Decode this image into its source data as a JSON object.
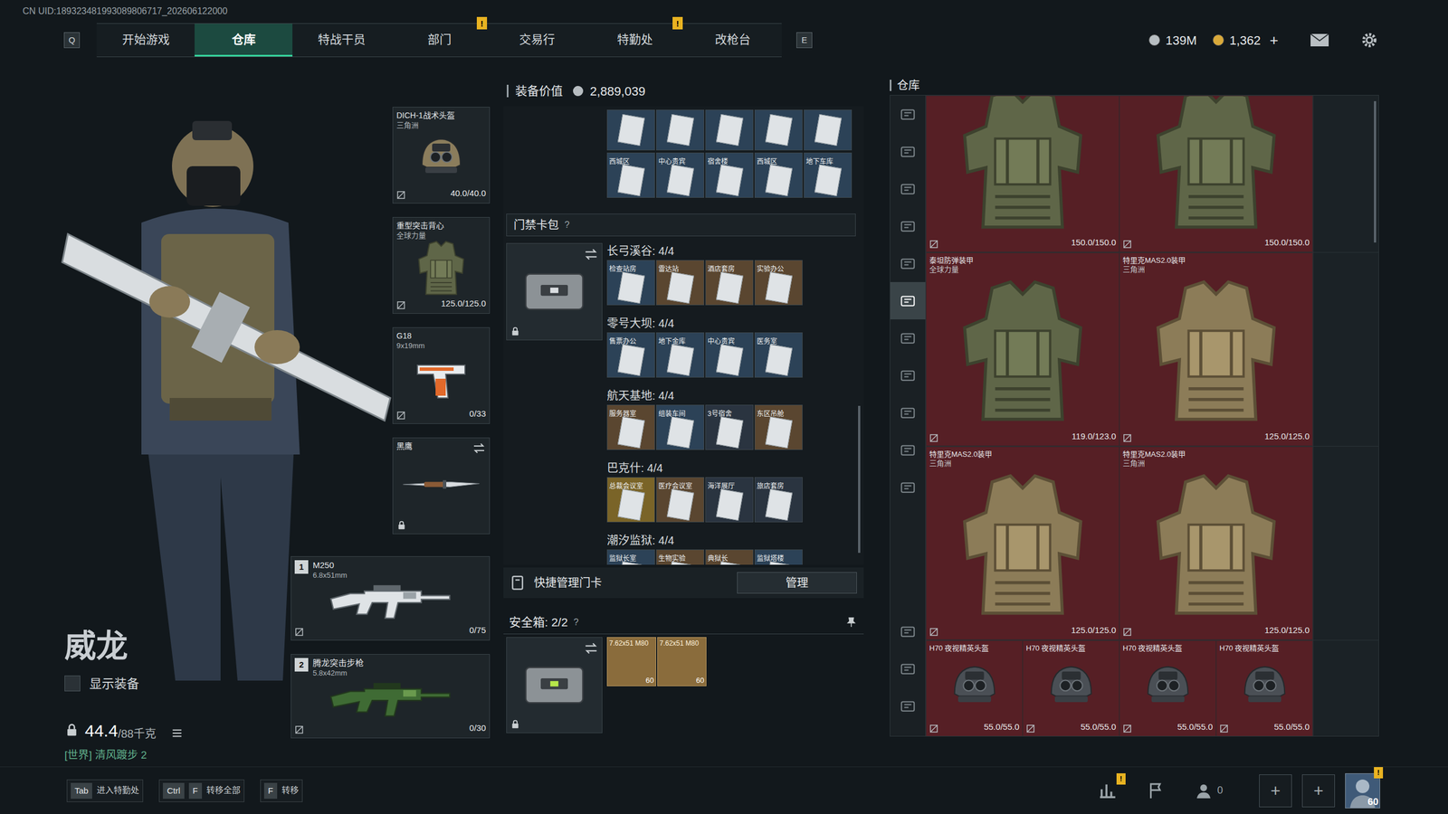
{
  "uid": "CN UID:189323481993089806717_202606122000",
  "nav": {
    "prev_key": "Q",
    "next_key": "E",
    "tabs": [
      {
        "label": "开始游戏",
        "selected": false
      },
      {
        "label": "仓库",
        "selected": true
      },
      {
        "label": "特战干员",
        "selected": false
      },
      {
        "label": "部门",
        "selected": false,
        "badge": "!"
      },
      {
        "label": "交易行",
        "selected": false
      },
      {
        "label": "特勤处",
        "selected": false,
        "badge": "!"
      },
      {
        "label": "改枪台",
        "selected": false
      }
    ]
  },
  "currency": [
    {
      "kind": "silver",
      "amount": "139M"
    },
    {
      "kind": "gold",
      "amount": "1,362"
    }
  ],
  "currency_add": "+",
  "operator": {
    "name": "威龙",
    "show_gear": {
      "label": "显示装备",
      "checked": false
    },
    "weight": {
      "current": "44.4",
      "max": "/88千克"
    },
    "world": "[世界] 清风踱步 2"
  },
  "gear": [
    {
      "kind": "helmet",
      "name": "DICH-1战术头盔",
      "sub": "三角洲",
      "durability": "40.0/40.0",
      "locked": false,
      "swap": false
    },
    {
      "kind": "vest",
      "name": "重型突击背心",
      "sub": "全球力量",
      "durability": "125.0/125.0",
      "locked": false,
      "swap": false
    },
    {
      "kind": "pistol",
      "name": "G18",
      "sub": "9x19mm",
      "durability": "0/33",
      "locked": false,
      "swap": false
    },
    {
      "kind": "knife",
      "name": "黑鹰",
      "locked": true,
      "swap": true
    }
  ],
  "weapons": [
    {
      "kind": "lmg",
      "slot": "1",
      "name": "M250",
      "caliber": "6.8x51mm",
      "ammo": "0/75"
    },
    {
      "kind": "rifle",
      "slot": "2",
      "name": "腾龙突击步枪",
      "caliber": "5.8x42mm",
      "ammo": "0/30"
    }
  ],
  "loadout": {
    "title": "装备价值",
    "value": "2,889,039",
    "top_cards_cut": [
      {
        "color": "#2c4257"
      },
      {
        "color": "#2c4257"
      },
      {
        "color": "#2c4257"
      },
      {
        "color": "#2c4257"
      },
      {
        "color": "#2c4257"
      }
    ],
    "top_cards": [
      {
        "label": "西城区",
        "color": "#2c4257"
      },
      {
        "label": "中心贵宾",
        "color": "#2c4257"
      },
      {
        "label": "宿舍楼",
        "color": "#2c4257"
      },
      {
        "label": "西城区",
        "color": "#2c4257"
      },
      {
        "label": "地下车库",
        "color": "#2c4257"
      }
    ],
    "keycard_pack": {
      "title": "门禁卡包",
      "help": "?",
      "locked": true
    },
    "groups": [
      {
        "title": "长弓溪谷: 4/4",
        "cards": [
          {
            "label": "检查站房",
            "color": "#2c4257"
          },
          {
            "label": "雷达站",
            "color": "#5a4630"
          },
          {
            "label": "酒店套房",
            "color": "#5a4630"
          },
          {
            "label": "实验办公",
            "color": "#5a4630"
          }
        ]
      },
      {
        "title": "零号大坝: 4/4",
        "cards": [
          {
            "label": "售票办公",
            "color": "#2c4257"
          },
          {
            "label": "地下金库",
            "color": "#2c4257"
          },
          {
            "label": "中心贵宾",
            "color": "#2c4257"
          },
          {
            "label": "医务室",
            "color": "#2c4257"
          }
        ]
      },
      {
        "title": "航天基地: 4/4",
        "cards": [
          {
            "label": "服务器室",
            "color": "#5a4630"
          },
          {
            "label": "组装车间",
            "color": "#2c4257"
          },
          {
            "label": "3号宿舍",
            "color": "#2a3440"
          },
          {
            "label": "东区吊舱",
            "color": "#5a4630"
          }
        ]
      },
      {
        "title": "巴克什: 4/4",
        "cards": [
          {
            "label": "总裁会议室",
            "color": "#7a6428"
          },
          {
            "label": "医疗会议室",
            "color": "#5a4630"
          },
          {
            "label": "海洋展厅",
            "color": "#2a3440"
          },
          {
            "label": "旅店套房",
            "color": "#2a3440"
          }
        ]
      },
      {
        "title": "潮汐监狱: 4/4",
        "cards": [
          {
            "label": "监狱长室",
            "color": "#2c4257"
          },
          {
            "label": "生物实验",
            "color": "#5a4630"
          },
          {
            "label": "典狱长",
            "color": "#5a4630"
          },
          {
            "label": "监狱塔楼",
            "color": "#2c4257"
          }
        ]
      }
    ],
    "quick_manage": {
      "label": "快捷管理门卡",
      "button": "管理"
    },
    "safebox": {
      "title": "安全箱: 2/2",
      "help": "?",
      "locked": true,
      "items": [
        {
          "name": "7.62x51 M80",
          "count": "60"
        },
        {
          "name": "7.62x51 M80",
          "count": "60"
        }
      ]
    }
  },
  "warehouse": {
    "title": "仓库",
    "sidebar_top": [
      {
        "selected": false
      },
      {
        "selected": false
      },
      {
        "selected": false
      },
      {
        "selected": false
      },
      {
        "selected": false
      },
      {
        "selected": true
      },
      {
        "selected": false
      },
      {
        "selected": false
      },
      {
        "selected": false
      },
      {
        "selected": false
      },
      {
        "selected": false
      }
    ],
    "sidebar_bottom": [
      {
        "selected": false
      },
      {
        "selected": false
      },
      {
        "selected": false
      }
    ],
    "rows": [
      {
        "items": [
          {
            "kind": "heavy",
            "durability": "150.0/150.0"
          },
          {
            "kind": "heavy",
            "durability": "150.0/150.0"
          }
        ]
      },
      {
        "items": [
          {
            "kind": "heavy",
            "name": "泰坦防弹装甲",
            "sub": "全球力量",
            "durability": "119.0/123.0"
          },
          {
            "kind": "plate",
            "name": "特里克MAS2.0装甲",
            "sub": "三角洲",
            "durability": "125.0/125.0"
          }
        ]
      },
      {
        "items": [
          {
            "kind": "plate",
            "name": "特里克MAS2.0装甲",
            "sub": "三角洲",
            "durability": "125.0/125.0"
          },
          {
            "kind": "plate",
            "name": "特里克MAS2.0装甲",
            "sub": "三角洲",
            "durability": "125.0/125.0"
          }
        ]
      },
      {
        "items": [
          {
            "kind": "helmet",
            "name": "H70 夜视精英头盔",
            "durability": "55.0/55.0"
          },
          {
            "kind": "helmet",
            "name": "H70 夜视精英头盔",
            "durability": "55.0/55.0"
          },
          {
            "kind": "helmet",
            "name": "H70 夜视精英头盔",
            "durability": "55.0/55.0"
          },
          {
            "kind": "helmet",
            "name": "H70 夜视精英头盔",
            "durability": "55.0/55.0"
          }
        ]
      }
    ]
  },
  "keys": [
    {
      "keys": [
        "Tab"
      ],
      "label": "进入特勤处"
    },
    {
      "keys": [
        "Ctrl",
        "F"
      ],
      "label": "转移全部"
    },
    {
      "keys": [
        "F"
      ],
      "label": "转移"
    }
  ],
  "bottom": {
    "stats_badge": "!",
    "friends": "0",
    "slots": [
      "+",
      "+"
    ],
    "level": "60",
    "avatar_badge": "!"
  }
}
